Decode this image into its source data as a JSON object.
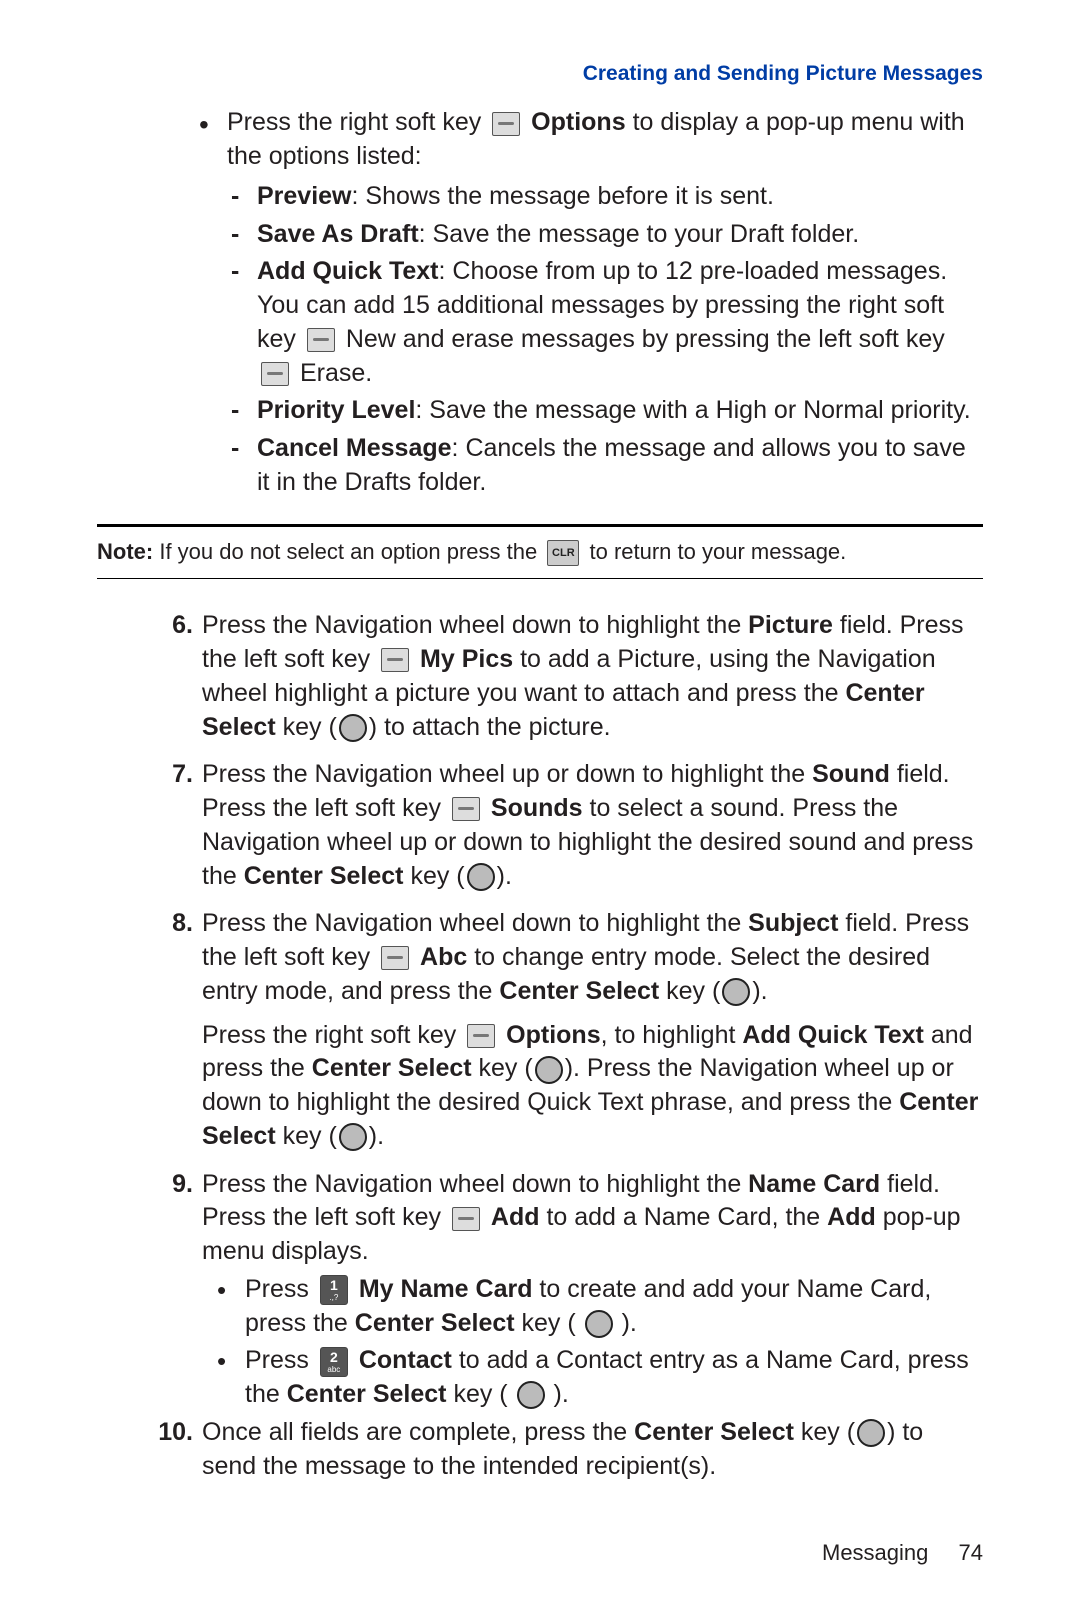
{
  "header": {
    "title": "Creating and Sending Picture Messages"
  },
  "intro": {
    "line_a": "Press the right soft key ",
    "options_bold": " Options",
    "line_b": " to display a pop-up menu with the options listed:"
  },
  "options": [
    {
      "name": "Preview",
      "desc": ": Shows the message before it is sent."
    },
    {
      "name": "Save As Draft",
      "desc": ": Save the message to your Draft folder."
    },
    {
      "name": "Add Quick Text",
      "desc_a": ": Choose from up to 12 pre-loaded messages. You can add 15 additional messages by pressing the right soft key ",
      "mid1": " New and erase messages by pressing the left soft key ",
      "mid2": " Erase."
    },
    {
      "name": "Priority Level",
      "desc": ": Save the message with a High or Normal priority."
    },
    {
      "name": "Cancel Message",
      "desc": ": Cancels the message and allows you to save it in the Drafts folder."
    }
  ],
  "note": {
    "label": "Note:",
    "a": " If you do not select an option press the ",
    "clr": "CLR",
    "b": " to return to your message."
  },
  "steps": {
    "s6": {
      "num": "6.",
      "a": "Press the Navigation wheel down to highlight the ",
      "picture": "Picture",
      "b": " field. Press the left soft key ",
      "mypics": " My Pics",
      "c": " to add a Picture, using the Navigation wheel highlight a picture you want to attach and press the ",
      "cs": "Center Select",
      "d": " key (",
      "e": ") to attach the picture."
    },
    "s7": {
      "num": "7.",
      "a": "Press the Navigation wheel up or down to highlight the ",
      "sound": "Sound",
      "b": " field. Press the left soft key ",
      "soundsb": " Sounds",
      "c": " to select a sound. Press the Navigation wheel up or down to highlight the desired sound and press the ",
      "cs": "Center Select",
      "d": " key (",
      "e": ")."
    },
    "s8": {
      "num": "8.",
      "a": "Press the Navigation wheel down to highlight the ",
      "subject": "Subject",
      "b": " field. Press the left soft key ",
      "abc": " Abc",
      "c": " to change entry mode. Select the desired entry mode, and press the ",
      "cs": "Center Select",
      "d": " key (",
      "e": ").",
      "p2a": "Press the right soft key ",
      "opts": " Options",
      "p2b": ", to highlight ",
      "aqt": "Add Quick Text",
      "p2c": " and press the ",
      "p2d": " key (",
      "p2e": "). Press the Navigation wheel up or down to highlight the desired Quick Text phrase, and press the ",
      "p2f": " key (",
      "p2g": ")."
    },
    "s9": {
      "num": "9.",
      "a": "Press the Navigation wheel down to highlight the ",
      "nc": "Name Card",
      "b": " field. Press the left soft key ",
      "add": " Add",
      "c": " to add a Name Card, the ",
      "add2": "Add",
      "d": " pop-up menu displays.",
      "i1a": "Press ",
      "i1key": "1",
      "i1sub": ".,?",
      "i1name": " My Name Card",
      "i1b": " to create and add your Name Card, press the ",
      "i1cs": "Center Select",
      "i1c": " key ( ",
      "i1d": " ).",
      "i2a": "Press ",
      "i2key": "2",
      "i2sub": "abc",
      "i2name": " Contact",
      "i2b": " to add a Contact entry as a Name Card, press the ",
      "i2cs": "Center Select",
      "i2c": " key ( ",
      "i2d": " )."
    },
    "s10": {
      "num": "10.",
      "a": "Once all fields are complete, press the ",
      "cs": "Center Select",
      "b": " key (",
      "c": ") to send the message to the intended recipient(s)."
    }
  },
  "footer": {
    "section": "Messaging",
    "page": "74"
  }
}
